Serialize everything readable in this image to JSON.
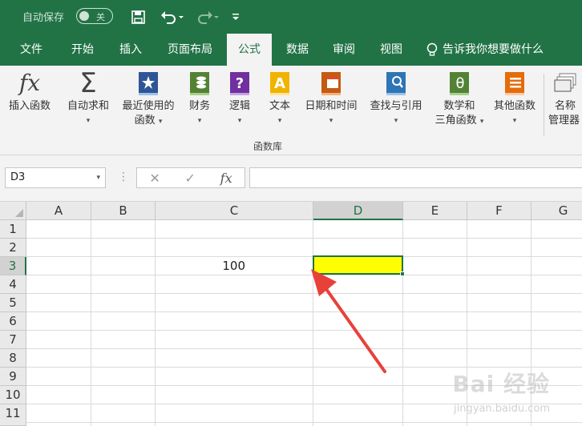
{
  "titlebar": {
    "autosave_label": "自动保存",
    "autosave_state": "关",
    "bg_color": "#217346",
    "icons": [
      "save-icon",
      "undo-icon",
      "redo-icon",
      "customize-qa-icon"
    ]
  },
  "tabs": [
    {
      "label": "文件",
      "active": false
    },
    {
      "label": "开始",
      "active": false
    },
    {
      "label": "插入",
      "active": false
    },
    {
      "label": "页面布局",
      "active": false
    },
    {
      "label": "公式",
      "active": true
    },
    {
      "label": "数据",
      "active": false
    },
    {
      "label": "审阅",
      "active": false
    },
    {
      "label": "视图",
      "active": false
    }
  ],
  "tellme": {
    "label": "告诉我你想要做什么",
    "icon": "lightbulb-icon"
  },
  "ribbon": {
    "group_label": "函数库",
    "buttons": [
      {
        "line1": "插入函数",
        "line2": "",
        "icon": "fx-icon"
      },
      {
        "line1": "自动求和",
        "line2": "",
        "icon": "sigma-icon"
      },
      {
        "line1": "最近使用的",
        "line2": "函数",
        "icon": "star-book-icon"
      },
      {
        "line1": "财务",
        "line2": "",
        "icon": "finance-book-icon"
      },
      {
        "line1": "逻辑",
        "line2": "",
        "icon": "logic-book-icon"
      },
      {
        "line1": "文本",
        "line2": "",
        "icon": "text-book-icon"
      },
      {
        "line1": "日期和时间",
        "line2": "",
        "icon": "calendar-book-icon"
      },
      {
        "line1": "查找与引用",
        "line2": "",
        "icon": "search-book-icon"
      },
      {
        "line1": "数学和",
        "line2": "三角函数",
        "icon": "theta-book-icon"
      },
      {
        "line1": "其他函数",
        "line2": "",
        "icon": "more-book-icon"
      },
      {
        "line1": "名称",
        "line2": "管理器",
        "icon": "name-manager-icon"
      }
    ]
  },
  "formula_bar": {
    "name_box": "D3",
    "cancel_glyph": "✕",
    "enter_glyph": "✓",
    "fx_glyph": "fx",
    "formula": ""
  },
  "sheet": {
    "columns": [
      "A",
      "B",
      "C",
      "D",
      "E",
      "F",
      "G"
    ],
    "selected_column": "D",
    "rows": [
      "1",
      "2",
      "3",
      "4",
      "5",
      "6",
      "7",
      "8",
      "9",
      "10",
      "11"
    ],
    "selected_row": "3",
    "cells": {
      "C3": "100",
      "D3": ""
    },
    "selected_cell": "D3",
    "selected_fill": "#ffff00",
    "accent_color": "#217346"
  },
  "annotation": {
    "arrow_color": "#e8413a"
  },
  "watermark": {
    "text": "Bai 经验",
    "sub": "jingyan.baidu.com"
  }
}
